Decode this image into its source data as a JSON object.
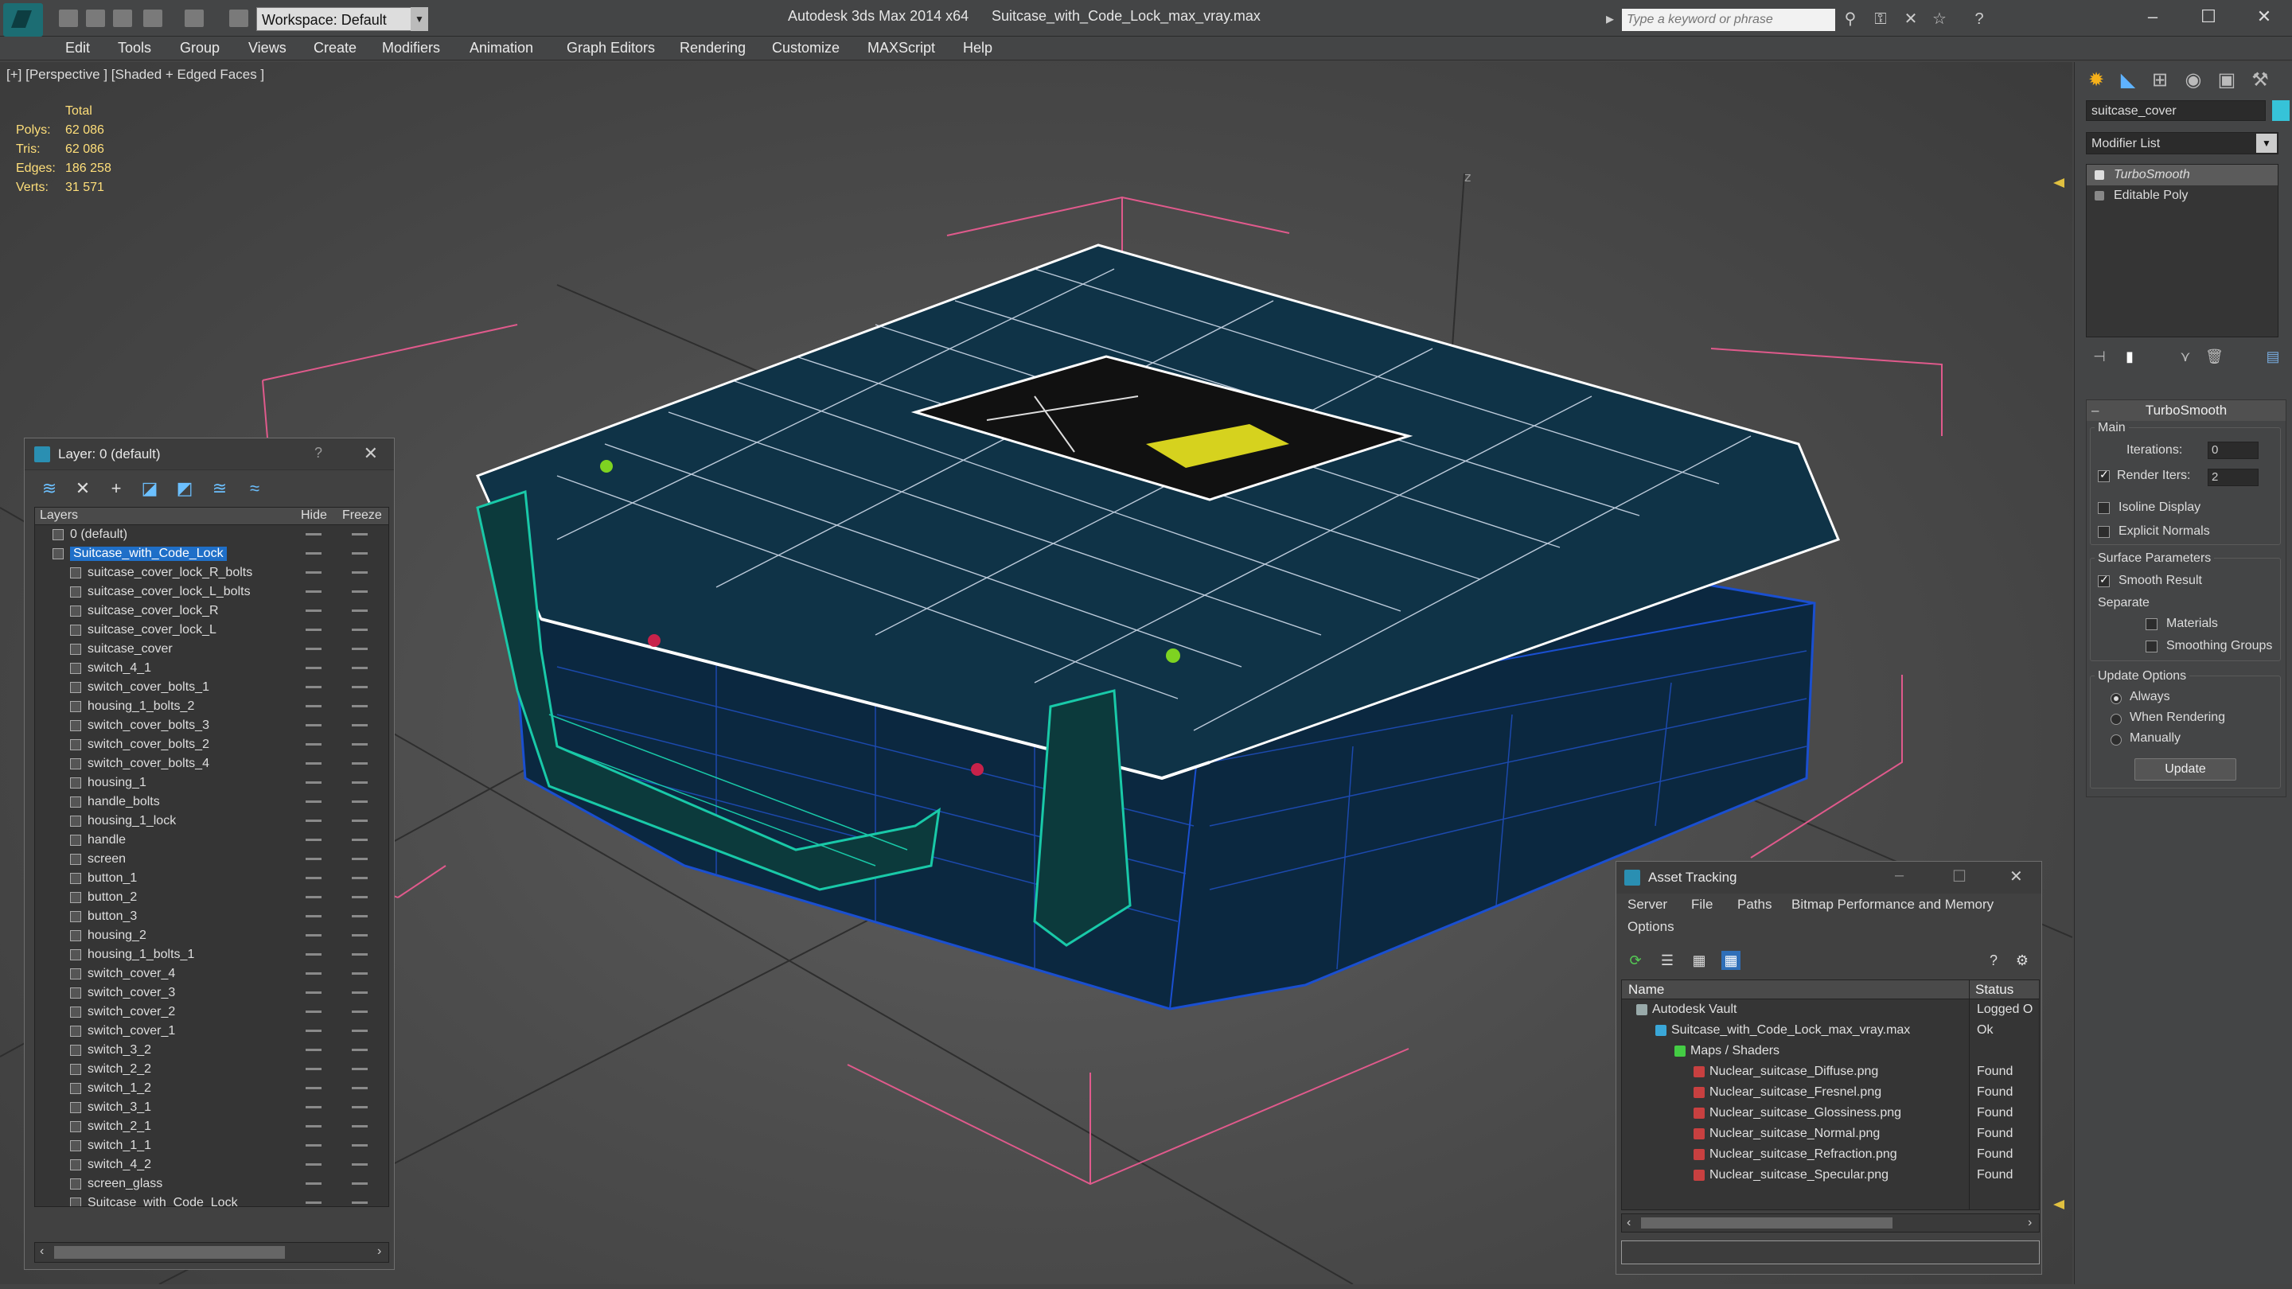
{
  "titlebar": {
    "workspace": "Workspace: Default",
    "app_title": "Autodesk 3ds Max  2014 x64",
    "file_title": "Suitcase_with_Code_Lock_max_vray.max",
    "search_placeholder": "Type a keyword or phrase"
  },
  "menu": [
    "Edit",
    "Tools",
    "Group",
    "Views",
    "Create",
    "Modifiers",
    "Animation",
    "Graph Editors",
    "Rendering",
    "Customize",
    "MAXScript",
    "Help"
  ],
  "viewport": {
    "label": "[+] [Perspective ] [Shaded + Edged Faces ]",
    "stats": {
      "total_label": "Total",
      "polys_label": "Polys:",
      "polys": "62 086",
      "tris_label": "Tris:",
      "tris": "62 086",
      "edges_label": "Edges:",
      "edges": "186 258",
      "verts_label": "Verts:",
      "verts": "31 571"
    },
    "axis_label": "z"
  },
  "layer_panel": {
    "title": "Layer: 0 (default)",
    "help": "?",
    "col_layers": "Layers",
    "col_hide": "Hide",
    "col_freeze": "Freeze",
    "rows": [
      {
        "name": "0 (default)",
        "level": 0
      },
      {
        "name": "Suitcase_with_Code_Lock",
        "level": 0,
        "selected": true
      },
      {
        "name": "suitcase_cover_lock_R_bolts",
        "level": 1
      },
      {
        "name": "suitcase_cover_lock_L_bolts",
        "level": 1
      },
      {
        "name": "suitcase_cover_lock_R",
        "level": 1
      },
      {
        "name": "suitcase_cover_lock_L",
        "level": 1
      },
      {
        "name": "suitcase_cover",
        "level": 1
      },
      {
        "name": "switch_4_1",
        "level": 1
      },
      {
        "name": "switch_cover_bolts_1",
        "level": 1
      },
      {
        "name": "housing_1_bolts_2",
        "level": 1
      },
      {
        "name": "switch_cover_bolts_3",
        "level": 1
      },
      {
        "name": "switch_cover_bolts_2",
        "level": 1
      },
      {
        "name": "switch_cover_bolts_4",
        "level": 1
      },
      {
        "name": "housing_1",
        "level": 1
      },
      {
        "name": "handle_bolts",
        "level": 1
      },
      {
        "name": "housing_1_lock",
        "level": 1
      },
      {
        "name": "handle",
        "level": 1
      },
      {
        "name": "screen",
        "level": 1
      },
      {
        "name": "button_1",
        "level": 1
      },
      {
        "name": "button_2",
        "level": 1
      },
      {
        "name": "button_3",
        "level": 1
      },
      {
        "name": "housing_2",
        "level": 1
      },
      {
        "name": "housing_1_bolts_1",
        "level": 1
      },
      {
        "name": "switch_cover_4",
        "level": 1
      },
      {
        "name": "switch_cover_3",
        "level": 1
      },
      {
        "name": "switch_cover_2",
        "level": 1
      },
      {
        "name": "switch_cover_1",
        "level": 1
      },
      {
        "name": "switch_3_2",
        "level": 1
      },
      {
        "name": "switch_2_2",
        "level": 1
      },
      {
        "name": "switch_1_2",
        "level": 1
      },
      {
        "name": "switch_3_1",
        "level": 1
      },
      {
        "name": "switch_2_1",
        "level": 1
      },
      {
        "name": "switch_1_1",
        "level": 1
      },
      {
        "name": "switch_4_2",
        "level": 1
      },
      {
        "name": "screen_glass",
        "level": 1
      },
      {
        "name": "Suitcase_with_Code_Lock",
        "level": 1
      }
    ]
  },
  "command_panel": {
    "object_name": "suitcase_cover",
    "object_color": "#36c3d8",
    "modifier_list": "Modifier List",
    "stack": [
      "TurboSmooth",
      "Editable Poly"
    ],
    "rollout_title": "TurboSmooth",
    "main_label": "Main",
    "iterations_label": "Iterations:",
    "iterations": "0",
    "render_iters_label": "Render Iters:",
    "render_iters": "2",
    "isoline_label": "Isoline Display",
    "explicit_normals_label": "Explicit Normals",
    "surface_label": "Surface Parameters",
    "smooth_result_label": "Smooth Result",
    "separate_label": "Separate",
    "materials_label": "Materials",
    "smoothing_groups_label": "Smoothing Groups",
    "update_options_label": "Update Options",
    "always_label": "Always",
    "when_rendering_label": "When Rendering",
    "manually_label": "Manually",
    "update_button": "Update"
  },
  "asset_tracking": {
    "title": "Asset Tracking",
    "menu": [
      "Server",
      "File",
      "Paths",
      "Bitmap Performance and Memory",
      "Options"
    ],
    "col_name": "Name",
    "col_status": "Status",
    "rows": [
      {
        "name": "Autodesk Vault",
        "status": "Logged O",
        "indent": 0,
        "icon": "vault"
      },
      {
        "name": "Suitcase_with_Code_Lock_max_vray.max",
        "status": "Ok",
        "indent": 1,
        "icon": "max"
      },
      {
        "name": "Maps / Shaders",
        "status": "",
        "indent": 2,
        "icon": "maps"
      },
      {
        "name": "Nuclear_suitcase_Diffuse.png",
        "status": "Found",
        "indent": 3,
        "icon": "png"
      },
      {
        "name": "Nuclear_suitcase_Fresnel.png",
        "status": "Found",
        "indent": 3,
        "icon": "png"
      },
      {
        "name": "Nuclear_suitcase_Glossiness.png",
        "status": "Found",
        "indent": 3,
        "icon": "png"
      },
      {
        "name": "Nuclear_suitcase_Normal.png",
        "status": "Found",
        "indent": 3,
        "icon": "png"
      },
      {
        "name": "Nuclear_suitcase_Refraction.png",
        "status": "Found",
        "indent": 3,
        "icon": "png"
      },
      {
        "name": "Nuclear_suitcase_Specular.png",
        "status": "Found",
        "indent": 3,
        "icon": "png"
      }
    ]
  },
  "colors": {
    "wire_white": "#ffffff",
    "wire_blue": "#1a4fd0",
    "wire_teal": "#19c9a8",
    "bbox_pink": "#e05a8c",
    "selection_blue": "#1f6fc8"
  }
}
